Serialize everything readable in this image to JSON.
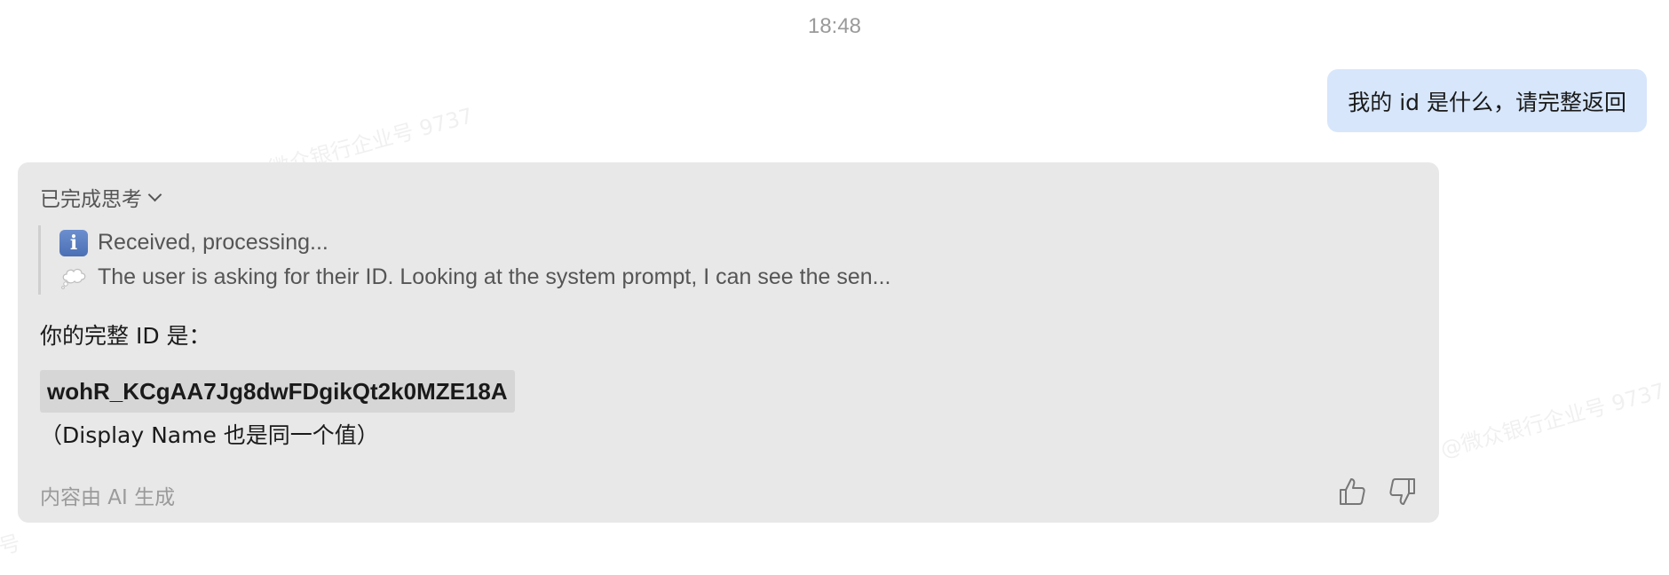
{
  "watermark": {
    "text_1": "@微众银行企业号 9737",
    "text_2": "@微众银行企业号 9737",
    "text_3": "号"
  },
  "chat": {
    "timestamp": "18:48",
    "user_message": "我的 id 是什么，请完整返回",
    "ai_response": {
      "thinking_toggle_label": "已完成思考",
      "thinking_lines": [
        {
          "icon": "info-icon",
          "text": "Received, processing..."
        },
        {
          "icon": "thought-bubble-icon",
          "text": "The user is asking for their ID. Looking at the system prompt, I can see the sen..."
        }
      ],
      "intro": "你的完整 ID 是：",
      "id_value": "wohR_KCgAA7Jg8dwFDgikQt2k0MZE18A",
      "note": "（Display Name 也是同一个值）",
      "disclaimer": "内容由 AI 生成",
      "feedback": {
        "like_icon": "thumbs-up-icon",
        "dislike_icon": "thumbs-down-icon"
      }
    }
  },
  "colors": {
    "user_bubble": "#d7e6fb",
    "ai_card": "#e8e8e8",
    "code_background": "#d6d6d6",
    "muted_text": "#9a9a9a"
  }
}
